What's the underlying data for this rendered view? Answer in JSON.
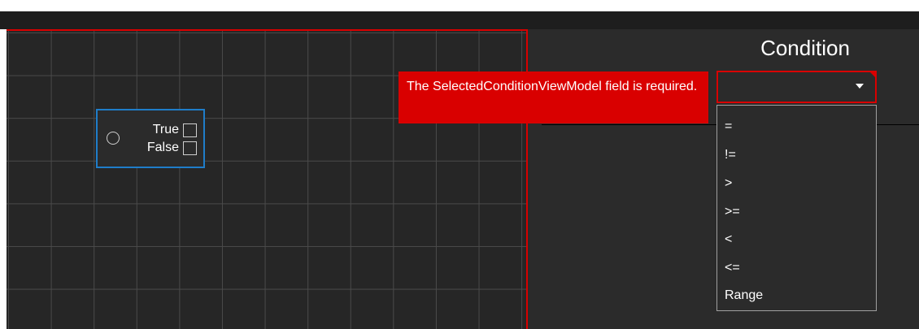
{
  "panel": {
    "title": "Condition"
  },
  "node": {
    "options": [
      {
        "label": "True",
        "checked": false
      },
      {
        "label": "False",
        "checked": false
      }
    ]
  },
  "validation": {
    "message": "The SelectedConditionViewModel field is required."
  },
  "condition_select": {
    "selected_value": "",
    "options": [
      "=",
      "!=",
      ">",
      ">=",
      "<",
      "<=",
      "Range"
    ]
  },
  "colors": {
    "error": "#d90000",
    "node_border": "#1f7dc9",
    "canvas_bg": "#262626",
    "grid_line": "#4a4a4a",
    "panel_bg": "#2b2b2b"
  }
}
